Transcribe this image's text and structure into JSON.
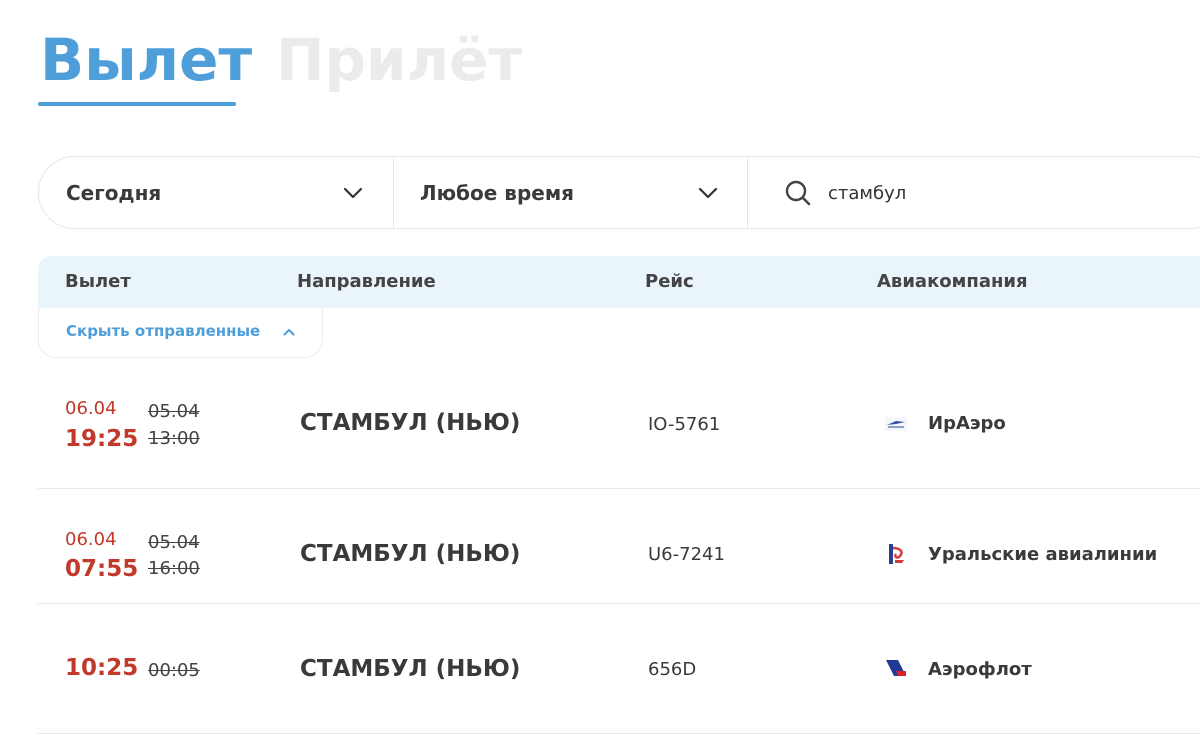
{
  "tabs": {
    "departure": "Вылет",
    "arrival": "Прилёт",
    "active": "departure"
  },
  "filters": {
    "date": "Сегодня",
    "time": "Любое время",
    "search_value": "стамбул"
  },
  "table": {
    "headers": {
      "departure": "Вылет",
      "direction": "Направление",
      "flight": "Рейс",
      "airline": "Авиакомпания"
    },
    "hide_sent_label": "Скрыть отправленные"
  },
  "flights": [
    {
      "new_date": "06.04",
      "new_time": "19:25",
      "old_date": "05.04",
      "old_time": "13:00",
      "direction": "СТАМБУЛ (НЬЮ)",
      "flight": "IO-5761",
      "airline": "ИрАэро",
      "airline_icon": "iraero-logo-icon"
    },
    {
      "new_date": "06.04",
      "new_time": "07:55",
      "old_date": "05.04",
      "old_time": "16:00",
      "direction": "СТАМБУЛ (НЬЮ)",
      "flight": "U6-7241",
      "airline": "Уральские авиалинии",
      "airline_icon": "ural-airlines-logo-icon"
    },
    {
      "new_time": "10:25",
      "old_time": "00:05",
      "direction": "СТАМБУЛ (НЬЮ)",
      "flight": "656D",
      "airline": "Аэрофлот",
      "airline_icon": "aeroflot-logo-icon"
    }
  ],
  "colors": {
    "accent": "#4e9ed9",
    "inactive_tab": "#ebebeb",
    "delayed": "#c0392b",
    "header_bg": "#eaf4fb"
  }
}
